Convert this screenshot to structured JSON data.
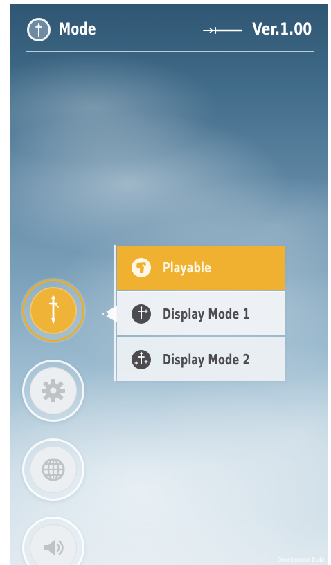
{
  "header": {
    "title": "Mode",
    "version": "Ver.1.00",
    "mode_icon": "sword-emblem-icon",
    "version_icon": "sword-icon"
  },
  "menu": {
    "items": [
      {
        "label": "Playable",
        "icon": "playable-character-icon",
        "selected": true
      },
      {
        "label": "Display Mode 1",
        "icon": "display-mode-1-icon",
        "selected": false
      },
      {
        "label": "Display Mode 2",
        "icon": "display-mode-2-icon",
        "selected": false
      }
    ]
  },
  "sidebar": {
    "buttons": [
      {
        "name": "mode",
        "icon": "sword-icon",
        "active": true
      },
      {
        "name": "settings",
        "icon": "gear-icon",
        "active": false
      },
      {
        "name": "language",
        "icon": "globe-icon",
        "active": false
      },
      {
        "name": "sound",
        "icon": "speaker-icon",
        "active": false
      }
    ]
  },
  "footer": {
    "build_label": "Development Build"
  },
  "colors": {
    "accent": "#efb12f",
    "menu_text": "#4c4b4f",
    "light_text": "#ffffff"
  }
}
